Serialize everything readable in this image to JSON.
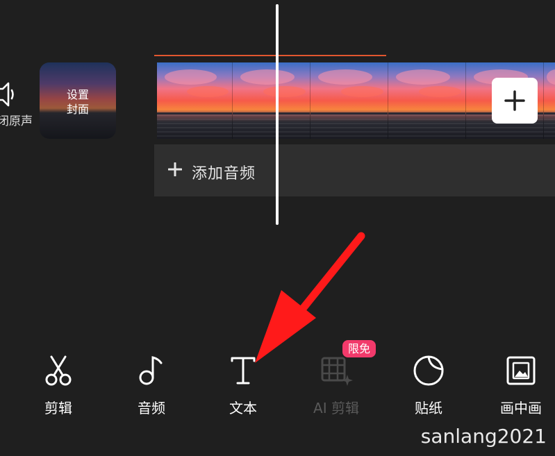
{
  "timeline": {
    "mute_label": "闭原声",
    "cover_label_line1": "设置",
    "cover_label_line2": "封面",
    "add_audio_label": "添加音频"
  },
  "toolbar": {
    "items": [
      {
        "label": "剪辑",
        "icon": "scissors-icon"
      },
      {
        "label": "音频",
        "icon": "music-note-icon"
      },
      {
        "label": "文本",
        "icon": "text-t-icon"
      },
      {
        "label": "AI 剪辑",
        "icon": "ai-film-icon",
        "disabled": true,
        "badge": "限免"
      },
      {
        "label": "贴纸",
        "icon": "sticker-icon"
      },
      {
        "label": "画中画",
        "icon": "picture-in-picture-icon"
      }
    ]
  },
  "watermark": "sanlang2021",
  "colors": {
    "background": "#1f1f1f",
    "timeline_marker": "#e2572f",
    "badge": "#f23a6b",
    "arrow": "#ff1a1a"
  }
}
